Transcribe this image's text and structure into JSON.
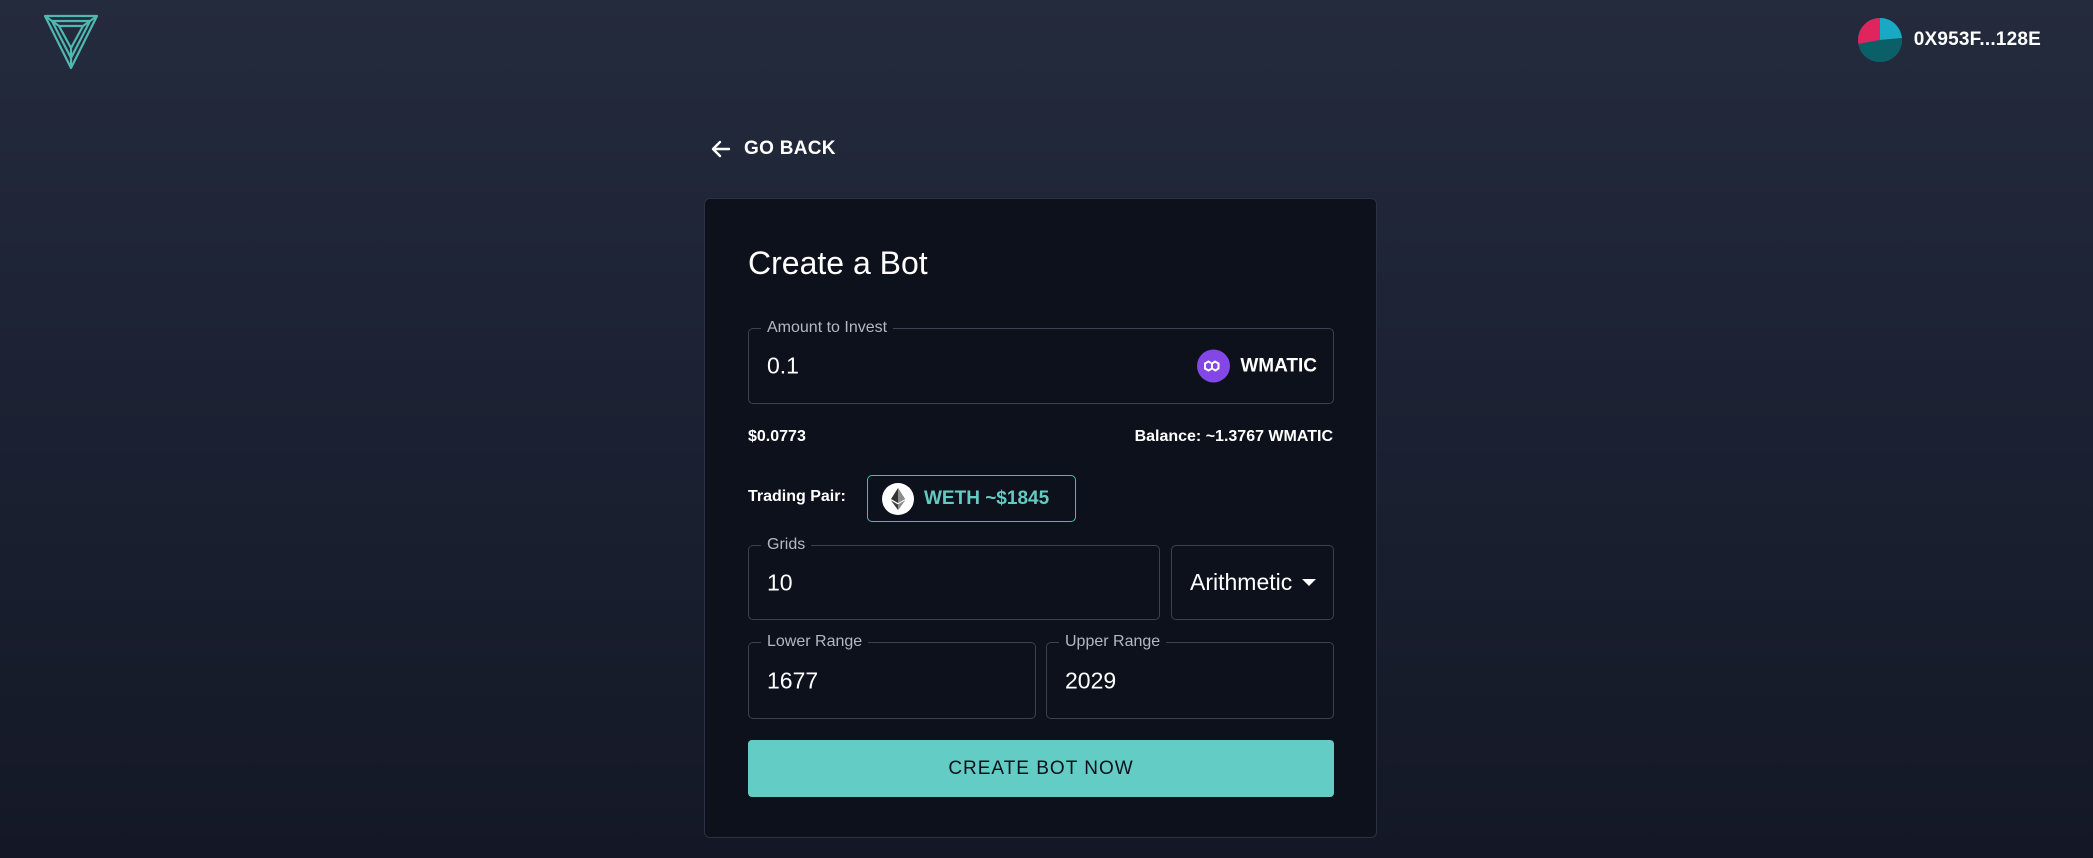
{
  "header": {
    "logo_icon": "shield-v-logo-icon",
    "wallet_address": "0X953F...128E",
    "avatar_icon": "wallet-avatar-icon"
  },
  "nav": {
    "go_back_label": "GO BACK",
    "back_icon": "arrow-left-icon"
  },
  "form": {
    "title": "Create a Bot",
    "amount": {
      "label": "Amount to Invest",
      "value": "0.1",
      "token": "WMATIC",
      "token_icon": "polygon-icon"
    },
    "usd_value": "$0.0773",
    "balance": "Balance: ~1.3767 WMATIC",
    "trading_pair": {
      "label": "Trading Pair:",
      "value": "WETH ~$1845",
      "icon": "ethereum-icon"
    },
    "grids": {
      "label": "Grids",
      "value": "10"
    },
    "grid_type": {
      "selected": "Arithmetic",
      "icon": "caret-down-icon"
    },
    "lower_range": {
      "label": "Lower Range",
      "value": "1677"
    },
    "upper_range": {
      "label": "Upper Range",
      "value": "2029"
    },
    "submit_label": "CREATE BOT NOW"
  },
  "colors": {
    "accent": "#63ccc4",
    "card_bg": "#0d111b",
    "polygon": "#8247e5"
  }
}
